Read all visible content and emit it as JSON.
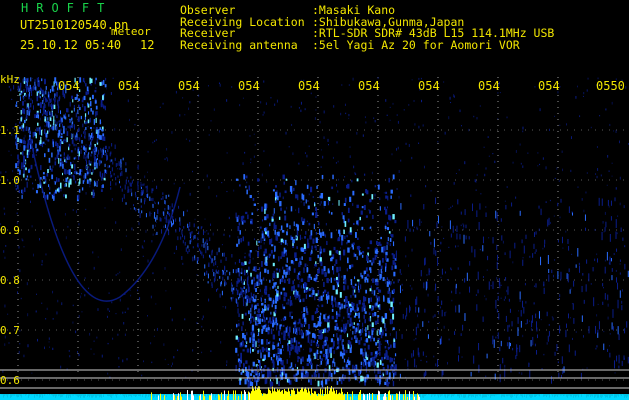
{
  "header": {
    "app_title": "HROFFT",
    "file_name": "UT2510120540.pn",
    "mode": "meteor",
    "date_time": "25.10.12 05:40",
    "count": "12",
    "info": [
      {
        "key": "Observer",
        "value": ":Masaki Kano"
      },
      {
        "key": "Receiving Location",
        "value": ":Shibukawa,Gunma,Japan"
      },
      {
        "key": "Receiver",
        "value": ":RTL-SDR SDR# 43dB L15 114.1MHz USB"
      },
      {
        "key": "Receiving antenna",
        "value": ":5el Yagi Az 20 for Aomori VOR"
      }
    ]
  },
  "axis": {
    "unit": "kHz",
    "y_labels": [
      "1.1",
      "1.0",
      "0.9",
      "0.8",
      "0.7",
      "0.6"
    ],
    "x_labels": [
      "054",
      "054",
      "054",
      "054",
      "054",
      "054",
      "054",
      "054",
      "054",
      "0550"
    ]
  },
  "colors": {
    "text": "#f2e600",
    "title": "#19d34a",
    "grid": "#ffffff",
    "signal_low": "#0a1d8a",
    "signal_mid": "#2a6cff",
    "signal_high": "#6ff0ff",
    "power_bar": "#ffff00",
    "power_base": "#00d8ff"
  }
}
